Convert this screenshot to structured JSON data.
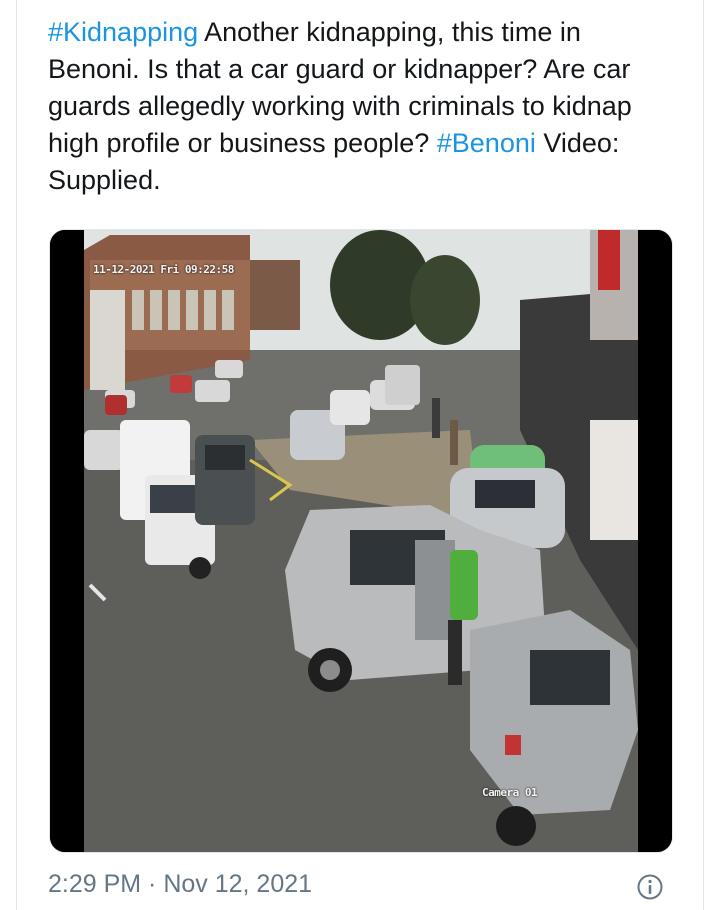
{
  "tweet": {
    "hashtag_1": "#Kidnapping",
    "text_1": " Another kidnapping, this time in Benoni. Is that a car guard or kidnapper? Are car guards allegedly working with criminals to kidnap high profile or business people? ",
    "hashtag_2": "#Benoni",
    "text_2": " Video: Supplied.",
    "timestamp": "2:29 PM · Nov 12, 2021"
  },
  "media": {
    "cctv_timestamp": "11-12-2021 Fri 09:22:58",
    "camera_label": "Camera 01"
  },
  "colors": {
    "hashtag": "#1b95e0",
    "text": "#14171a",
    "meta": "#657786"
  },
  "icons": {
    "info": "info-circle-icon"
  }
}
